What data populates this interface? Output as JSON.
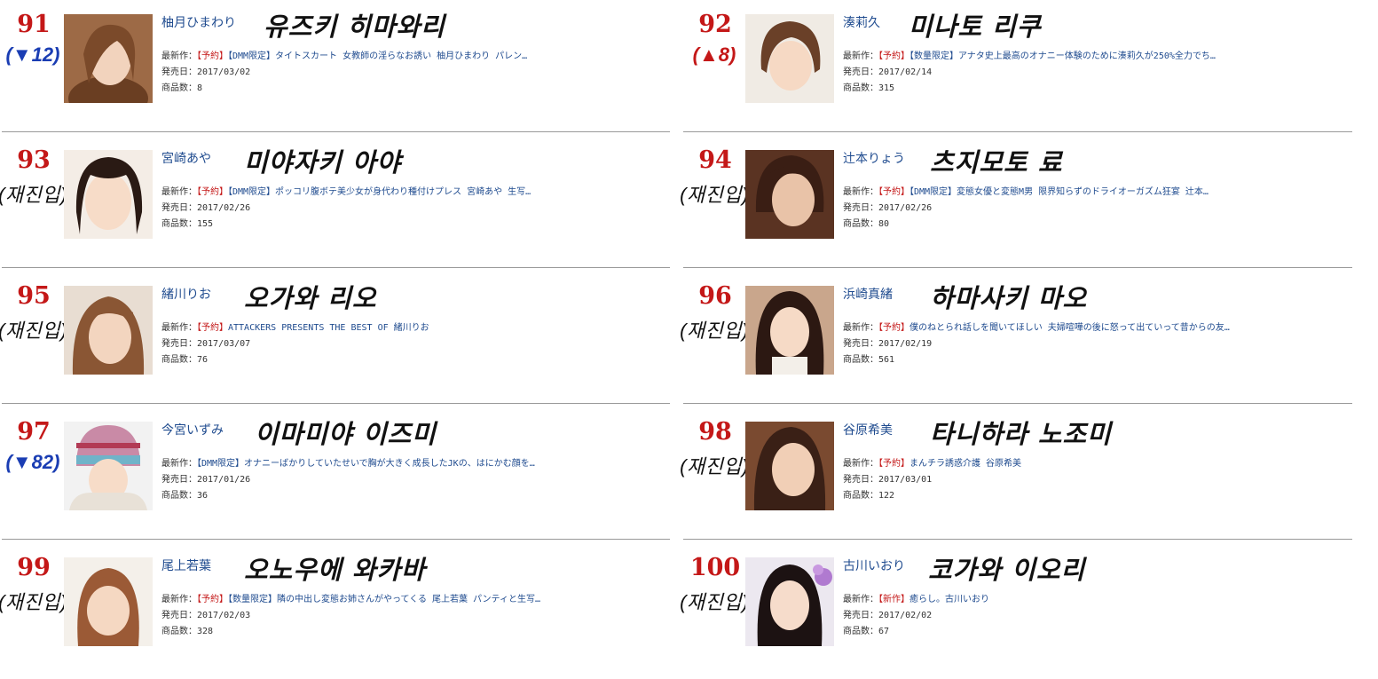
{
  "entries": [
    {
      "rank": "91",
      "change": "(▼12)",
      "change_kind": "down",
      "jp_name": "柚月ひまわり",
      "kr_name": "유즈키 히마와리",
      "latest_label": "最新作：",
      "tag": "【予約】",
      "title": "【DMM限定】タイトスカート 女教師の淫らなお誘い 柚月ひまわり パレン…",
      "release_label": "発売日：",
      "release": "2017/03/02",
      "count_label": "商品数：",
      "count": "8"
    },
    {
      "rank": "92",
      "change": "(▲8)",
      "change_kind": "up",
      "jp_name": "湊莉久",
      "kr_name": "미나토 리쿠",
      "latest_label": "最新作：",
      "tag": "【予約】",
      "title": "【数量限定】アナタ史上最高のオナニー体験のために湊莉久が250%全力でち…",
      "release_label": "発売日：",
      "release": "2017/02/14",
      "count_label": "商品数：",
      "count": "315"
    },
    {
      "rank": "93",
      "change": "(재진입)",
      "change_kind": "re",
      "jp_name": "宮崎あや",
      "kr_name": "미야자키 아야",
      "latest_label": "最新作：",
      "tag": "【予約】",
      "title": "【DMM限定】ポッコリ腹ボテ美少女が身代わり種付けプレス 宮崎あや 生写…",
      "release_label": "発売日：",
      "release": "2017/02/26",
      "count_label": "商品数：",
      "count": "155"
    },
    {
      "rank": "94",
      "change": "(재진입)",
      "change_kind": "re",
      "jp_name": "辻本りょう",
      "kr_name": "츠지모토 료",
      "latest_label": "最新作：",
      "tag": "【予約】",
      "title": "【DMM限定】変態女優と変態M男 限界知らずのドライオーガズム狂宴 辻本…",
      "release_label": "発売日：",
      "release": "2017/02/26",
      "count_label": "商品数：",
      "count": "80"
    },
    {
      "rank": "95",
      "change": "(재진입)",
      "change_kind": "re",
      "jp_name": "緒川りお",
      "kr_name": "오가와 리오",
      "latest_label": "最新作：",
      "tag": "【予約】",
      "title": "ATTACKERS PRESENTS THE BEST OF 緒川りお",
      "release_label": "発売日：",
      "release": "2017/03/07",
      "count_label": "商品数：",
      "count": "76"
    },
    {
      "rank": "96",
      "change": "(재진입)",
      "change_kind": "re",
      "jp_name": "浜崎真緒",
      "kr_name": "하마사키 마오",
      "latest_label": "最新作：",
      "tag": "【予約】",
      "title": "僕のねとられ話しを聞いてほしい 夫婦喧嘩の後に怒って出ていって昔からの友…",
      "release_label": "発売日：",
      "release": "2017/02/19",
      "count_label": "商品数：",
      "count": "561"
    },
    {
      "rank": "97",
      "change": "(▼82)",
      "change_kind": "down",
      "jp_name": "今宮いずみ",
      "kr_name": "이마미야 이즈미",
      "latest_label": "最新作：",
      "tag": "",
      "title": "【DMM限定】オナニーばかりしていたせいで胸が大きく成長したJKの、はにかむ顔を…",
      "release_label": "発売日：",
      "release": "2017/01/26",
      "count_label": "商品数：",
      "count": "36"
    },
    {
      "rank": "98",
      "change": "(재진입)",
      "change_kind": "re",
      "jp_name": "谷原希美",
      "kr_name": "타니하라 노조미",
      "latest_label": "最新作：",
      "tag": "【予約】",
      "title": "まんチラ誘惑介護 谷原希美",
      "release_label": "発売日：",
      "release": "2017/03/01",
      "count_label": "商品数：",
      "count": "122"
    },
    {
      "rank": "99",
      "change": "(재진입)",
      "change_kind": "re",
      "jp_name": "尾上若葉",
      "kr_name": "오노우에 와카바",
      "latest_label": "最新作：",
      "tag": "【予約】",
      "title": "【数量限定】隣の中出し変態お姉さんがやってくる 尾上若葉 パンティと生写…",
      "release_label": "発売日：",
      "release": "2017/02/03",
      "count_label": "商品数：",
      "count": "328"
    },
    {
      "rank": "100",
      "change": "(재진입)",
      "change_kind": "re",
      "jp_name": "古川いおり",
      "kr_name": "코가와 이오리",
      "latest_label": "最新作：",
      "tag": "【新作】",
      "title": "癒らし。古川いおり",
      "release_label": "発売日：",
      "release": "2017/02/02",
      "count_label": "商品数：",
      "count": "67"
    }
  ],
  "colors": {
    "rank": "#c41818",
    "down": "#1a3db3",
    "up": "#c41818",
    "jp_name": "#1f4b8f",
    "divider": "#999999"
  }
}
